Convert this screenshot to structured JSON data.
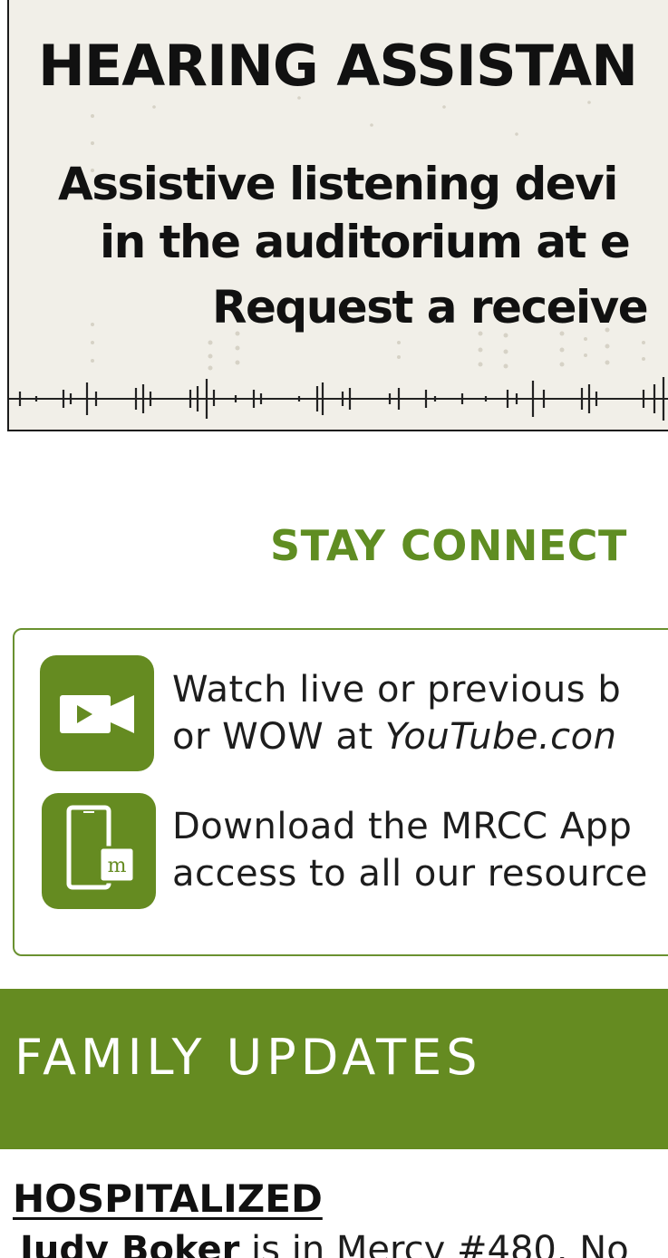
{
  "hearing": {
    "title": "HEARING ASSISTAN",
    "line1": "Assistive listening devi",
    "line2": "in the auditorium at e",
    "line3": "Request a receive"
  },
  "stay_connected": {
    "title": "STAY CONNECT",
    "items": [
      {
        "icon": "video-camera-icon",
        "line1": "Watch live or previous b",
        "line2_prefix": "or WOW at ",
        "line2_link": "YouTube.con"
      },
      {
        "icon": "phone-app-icon",
        "app_badge": "m",
        "line1": "Download the MRCC App",
        "line2": "access to all our resource"
      }
    ]
  },
  "family_updates": {
    "title": "FAMILY UPDATES",
    "section_heading": "HOSPITALIZED",
    "entries": [
      {
        "name": "Judy Boker",
        "text": " is in Mercy #480. No"
      }
    ]
  },
  "colors": {
    "green": "#658b21",
    "title_green": "#5f8d22",
    "banner_bg": "#f1efe8"
  }
}
